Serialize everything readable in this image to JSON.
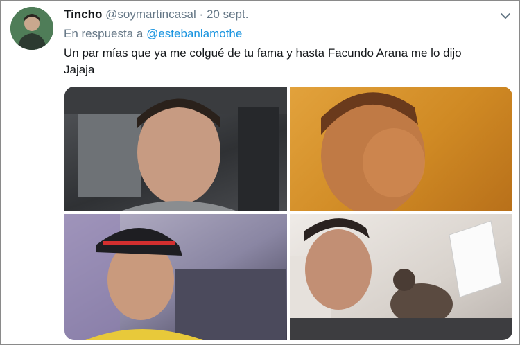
{
  "tweet": {
    "display_name": "Tincho",
    "handle": "@soymartincasal",
    "separator": "·",
    "date": "20 sept.",
    "reply_prefix": "En respuesta a",
    "reply_handle": "@estebanlamothe",
    "text_line1": "Un par mías que ya me colgué de tu fama y hasta Facundo Arana me lo dijo",
    "text_line2": "Jajaja",
    "menu_icon": "chevron-down-icon"
  },
  "media": {
    "count": 4
  },
  "colors": {
    "text": "#14171a",
    "muted": "#657786",
    "link": "#1b95e0"
  }
}
